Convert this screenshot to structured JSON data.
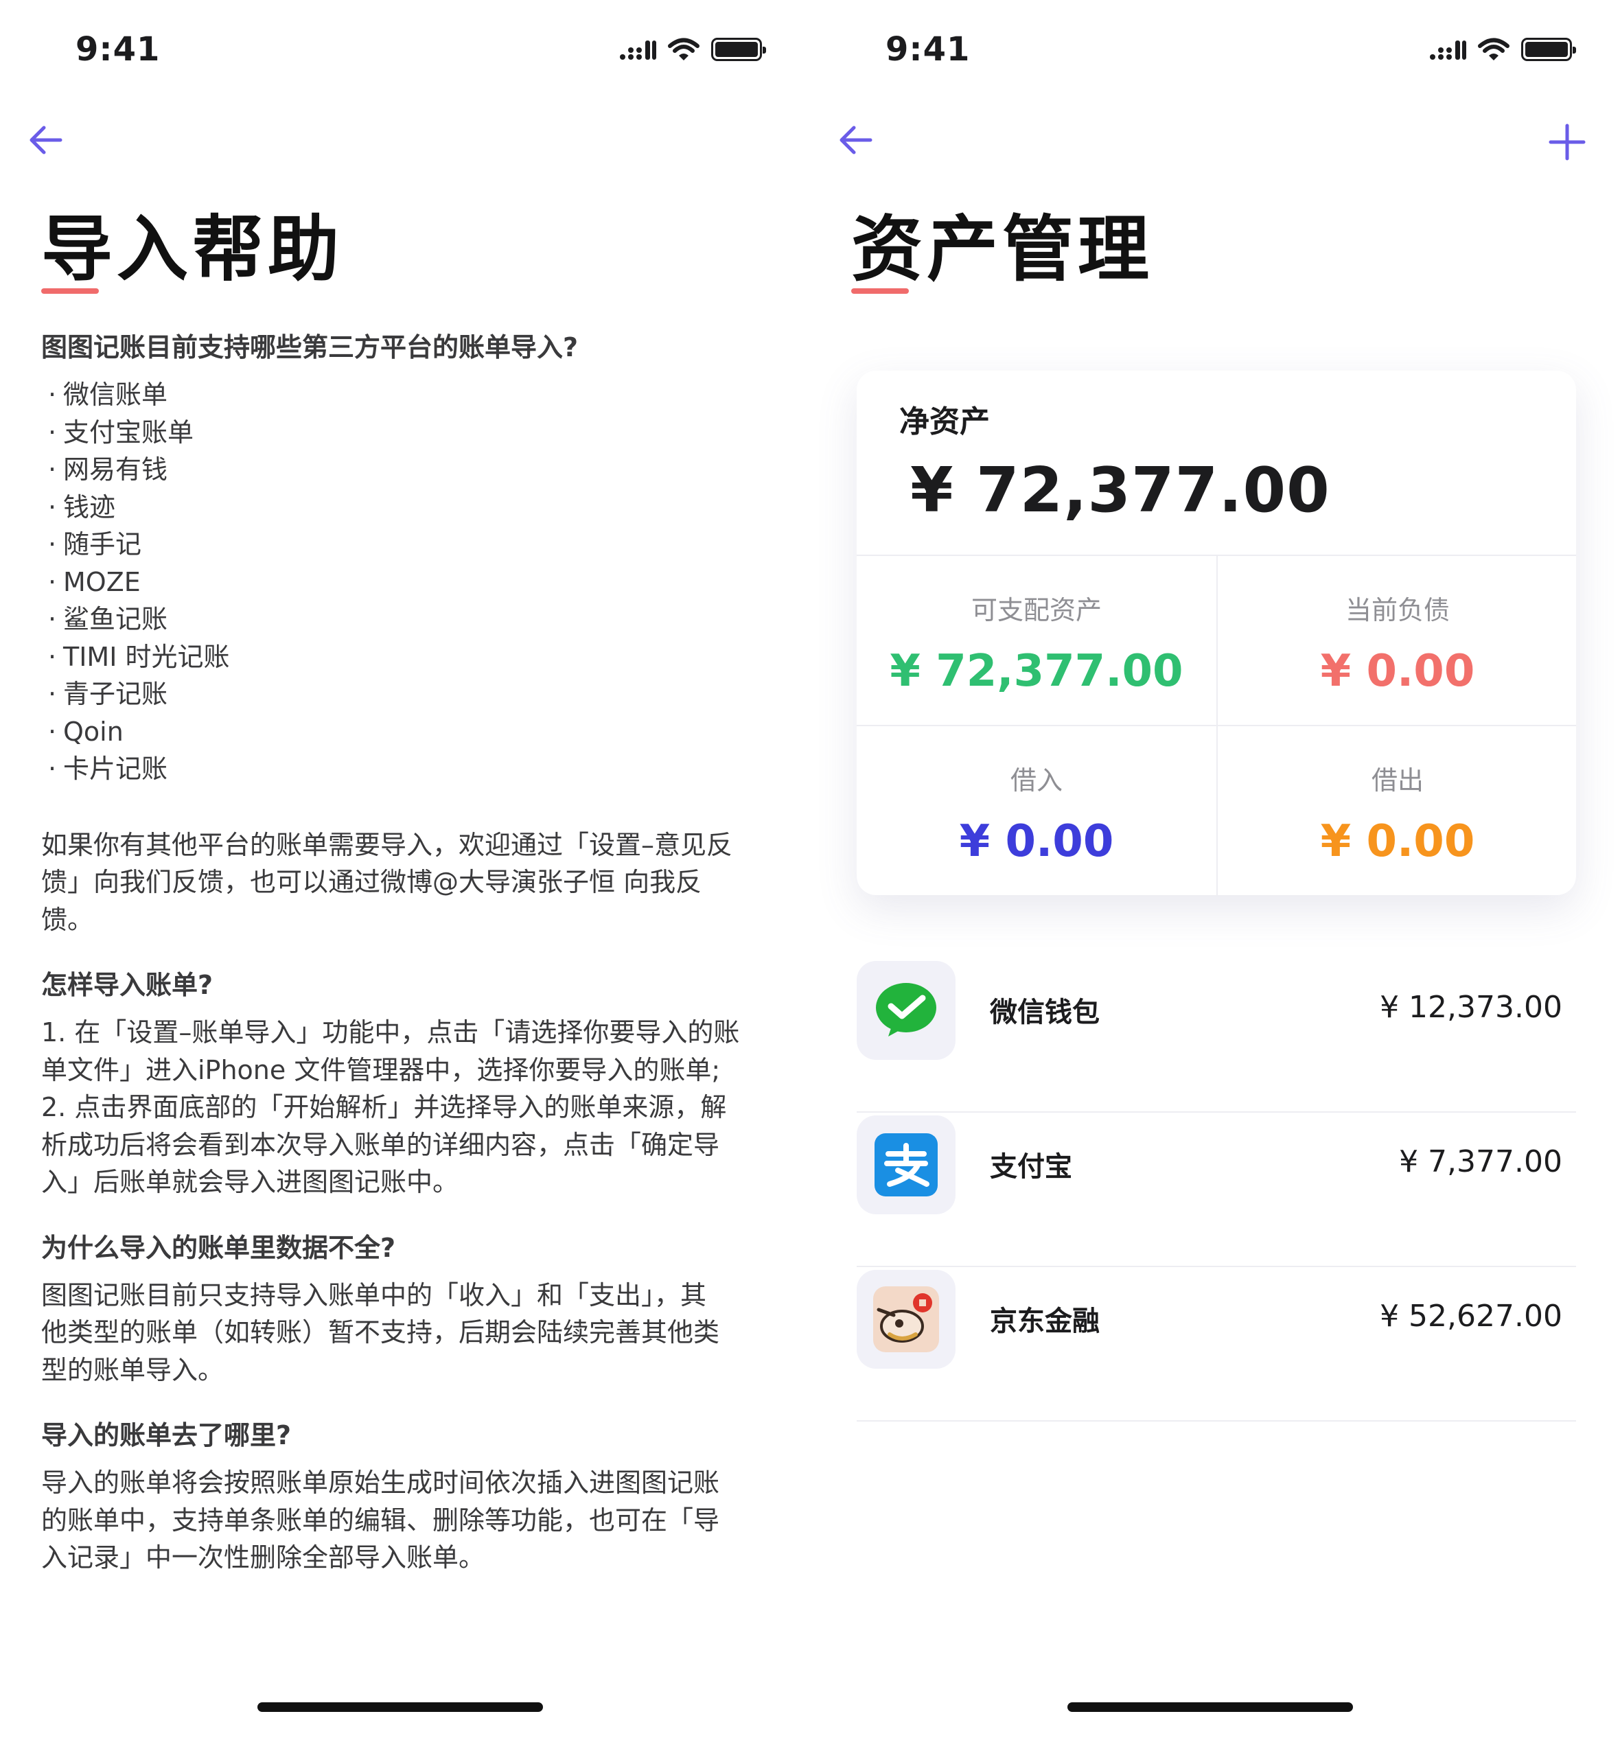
{
  "left": {
    "status": {
      "time": "9:41"
    },
    "title": "导入帮助",
    "sections": {
      "q1": "图图记账目前支持哪些第三方平台的账单导入?",
      "platforms": [
        "微信账单",
        "支付宝账单",
        "网易有钱",
        "钱迹",
        "随手记",
        "MOZE",
        "鲨鱼记账",
        "TIMI 时光记账",
        "青子记账",
        "Qoin",
        "卡片记账"
      ],
      "p1_l1": "如果你有其他平台的账单需要导入，欢迎通过「设置–意见反",
      "p1_l2": "馈」向我们反馈，也可以通过微博@大导演张子恒 向我反",
      "p1_l3": "馈。",
      "q2": "怎样导入账单?",
      "p2_l1": "1. 在「设置–账单导入」功能中，点击「请选择你要导入的账",
      "p2_l2": "单文件」进入iPhone 文件管理器中，选择你要导入的账单;",
      "p2_l3": "2. 点击界面底部的「开始解析」并选择导入的账单来源，解",
      "p2_l4": "析成功后将会看到本次导入账单的详细内容，点击「确定导",
      "p2_l5": "入」后账单就会导入进图图记账中。",
      "q3": "为什么导入的账单里数据不全?",
      "p3_l1": "图图记账目前只支持导入账单中的「收入」和「支出」，其",
      "p3_l2": "他类型的账单（如转账）暂不支持，后期会陆续完善其他类",
      "p3_l3": "型的账单导入。",
      "q4": "导入的账单去了哪里?",
      "p4_l1": "导入的账单将会按照账单原始生成时间依次插入进图图记账",
      "p4_l2": "的账单中，支持单条账单的编辑、删除等功能，也可在「导",
      "p4_l3": "入记录」中一次性删除全部导入账单。"
    }
  },
  "right": {
    "status": {
      "time": "9:41"
    },
    "title": "资产管理",
    "card": {
      "net_label": "净资产",
      "net_value": "¥ 72,377.00",
      "disposable_label": "可支配资产",
      "disposable_value": "¥ 72,377.00",
      "liability_label": "当前负债",
      "liability_value": "¥ 0.00",
      "borrow_in_label": "借入",
      "borrow_in_value": "¥ 0.00",
      "borrow_out_label": "借出",
      "borrow_out_value": "¥ 0.00"
    },
    "accounts": [
      {
        "name": "微信钱包",
        "amount": "¥ 12,373.00",
        "icon": "wechat-icon"
      },
      {
        "name": "支付宝",
        "amount": "¥ 7,377.00",
        "icon": "alipay-icon"
      },
      {
        "name": "京东金融",
        "amount": "¥ 52,627.00",
        "icon": "jd-finance-icon"
      }
    ]
  },
  "colors": {
    "accent": "#6a5ce8",
    "title_underline": "#f06b6b",
    "green": "#2fbf71",
    "red": "#f2706b",
    "blue": "#3d3ddb",
    "orange": "#f7941d"
  }
}
